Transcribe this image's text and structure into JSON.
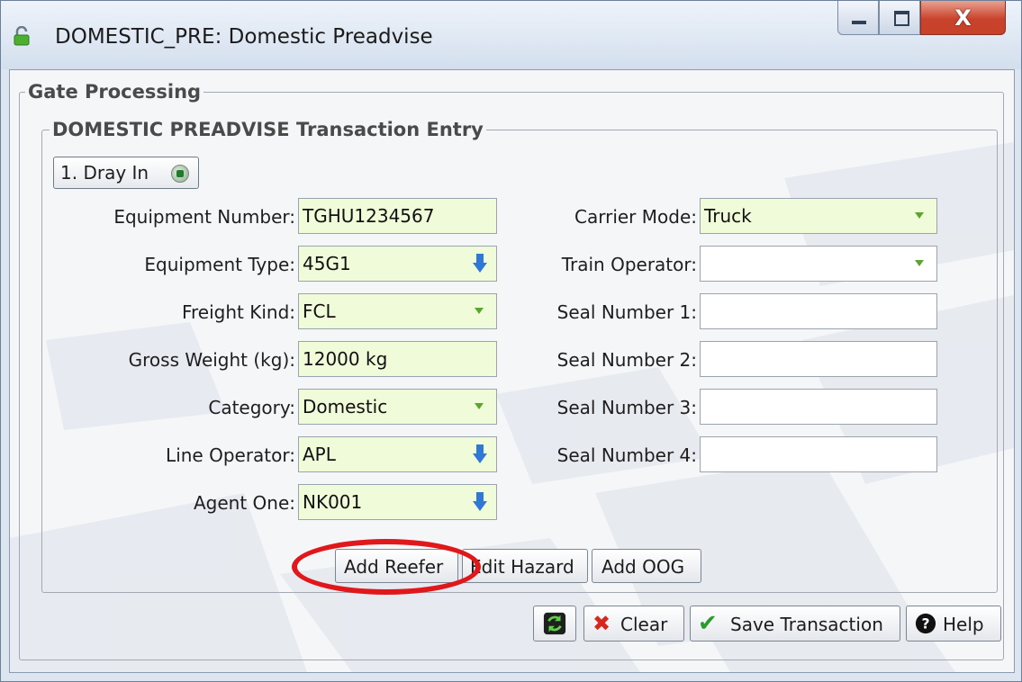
{
  "window": {
    "title": "DOMESTIC_PRE: Domestic Preadvise",
    "close_glyph": "X"
  },
  "gate_processing": {
    "legend": "Gate Processing"
  },
  "transaction_entry": {
    "legend": "DOMESTIC PREADVISE Transaction Entry",
    "mode_button": "1. Dray In"
  },
  "left_fields": [
    {
      "label": "Equipment Number:",
      "value": "TGHU1234567",
      "control": "text"
    },
    {
      "label": "Equipment Type:",
      "value": "45G1",
      "control": "lookup"
    },
    {
      "label": "Freight Kind:",
      "value": "FCL",
      "control": "dropdown"
    },
    {
      "label": "Gross Weight (kg):",
      "value": "12000 kg",
      "control": "text"
    },
    {
      "label": "Category:",
      "value": "Domestic",
      "control": "dropdown"
    },
    {
      "label": "Line Operator:",
      "value": "APL",
      "control": "lookup"
    },
    {
      "label": "Agent One:",
      "value": "NK001",
      "control": "lookup"
    }
  ],
  "right_fields": [
    {
      "label": "Carrier Mode:",
      "value": "Truck",
      "control": "dropdown"
    },
    {
      "label": "Train Operator:",
      "value": "",
      "control": "dropdown"
    },
    {
      "label": "Seal Number 1:",
      "value": "",
      "control": "text"
    },
    {
      "label": "Seal Number 2:",
      "value": "",
      "control": "text"
    },
    {
      "label": "Seal Number 3:",
      "value": "",
      "control": "text"
    },
    {
      "label": "Seal Number 4:",
      "value": "",
      "control": "text"
    }
  ],
  "action_buttons": {
    "add_reefer": "Add Reefer",
    "edit_hazard": "Edit Hazard",
    "add_oog": "Add OOG"
  },
  "footer": {
    "clear": "Clear",
    "save": "Save Transaction",
    "help": "Help"
  },
  "colors": {
    "required_field": "#f0fbd9",
    "highlight_circle": "#e0181b",
    "dropdown_caret": "#5ca530",
    "lookup_arrow": "#2f78d8"
  }
}
